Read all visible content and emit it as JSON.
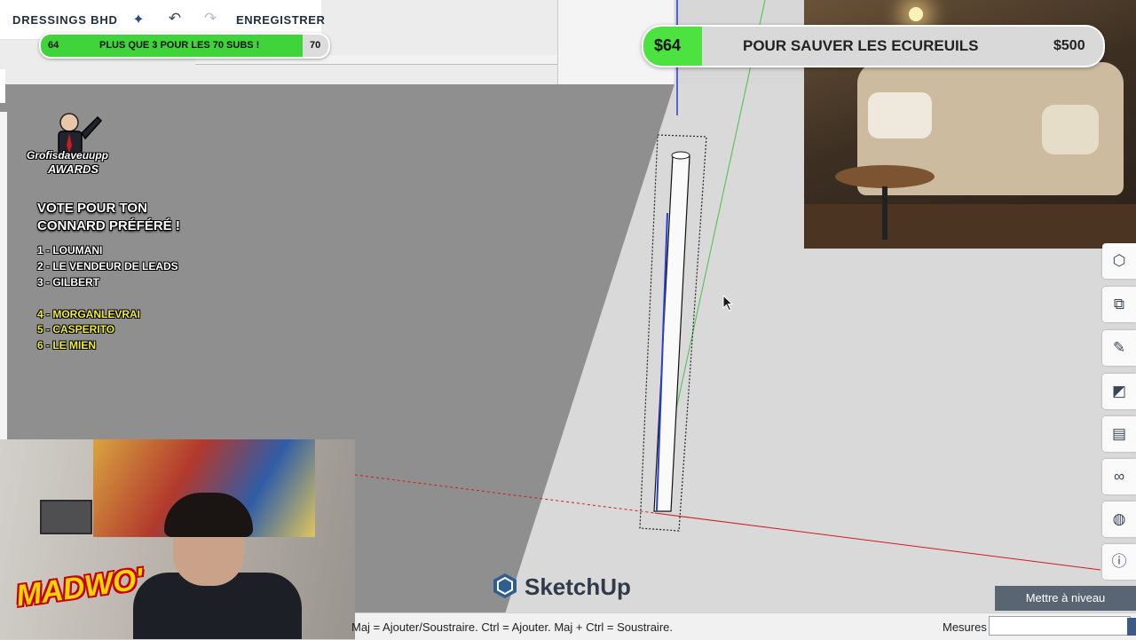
{
  "toolbar": {
    "project_name": "DRESSINGS BHD",
    "save_label": "ENREGISTRER",
    "ai_icon": "sparkle-icon",
    "undo_icon": "undo-icon",
    "redo_icon": "redo-icon"
  },
  "subs_goal": {
    "start": "64",
    "label": "PLUS QUE 3 POUR LES 70 SUBS !",
    "end": "70",
    "progress_fraction": 0.91,
    "fill_color": "#3fd43a"
  },
  "donation": {
    "current": "$64",
    "label": "POUR SAUVER LES ECUREUILS",
    "target": "$500",
    "progress_fraction": 0.128,
    "fill_color": "#4ce240"
  },
  "awards": {
    "name": "Grofisdaveuupp",
    "subtitle": "AWARDS",
    "vote_title_line1": "VOTE POUR TON",
    "vote_title_line2": "CONNARD PRÉFÉRÉ !",
    "candidates": [
      "1 - LOUMANI",
      "2 - LE VENDEUR DE LEADS",
      "3 - GILBERT",
      "4 - MORGANLEVRAI",
      "5 - CASPERITO",
      "6 - LE MIEN"
    ],
    "highlight_color": "#f3ef2a"
  },
  "facecam": {
    "overlay_text": "MADWO'"
  },
  "right_toolbar": [
    {
      "icon": "view-cube-icon",
      "glyph": "⬡"
    },
    {
      "icon": "components-icon",
      "glyph": "⧉"
    },
    {
      "icon": "pencil-icon",
      "glyph": "✎"
    },
    {
      "icon": "paint-bucket-icon",
      "glyph": "◩"
    },
    {
      "icon": "scenes-icon",
      "glyph": "▤"
    },
    {
      "icon": "glasses-icon",
      "glyph": "∞"
    },
    {
      "icon": "globe-icon",
      "glyph": "◍"
    },
    {
      "icon": "info-icon",
      "glyph": "ⓘ"
    }
  ],
  "brand": {
    "name": "SketchUp",
    "color": "#2f5f8f"
  },
  "status_bar": {
    "hint": "Maj = Ajouter/Soustraire. Ctrl = Ajouter. Maj + Ctrl = Soustraire.",
    "measures_label": "Mesures",
    "measures_value": ""
  },
  "upgrade": {
    "label": "Mettre à niveau"
  }
}
